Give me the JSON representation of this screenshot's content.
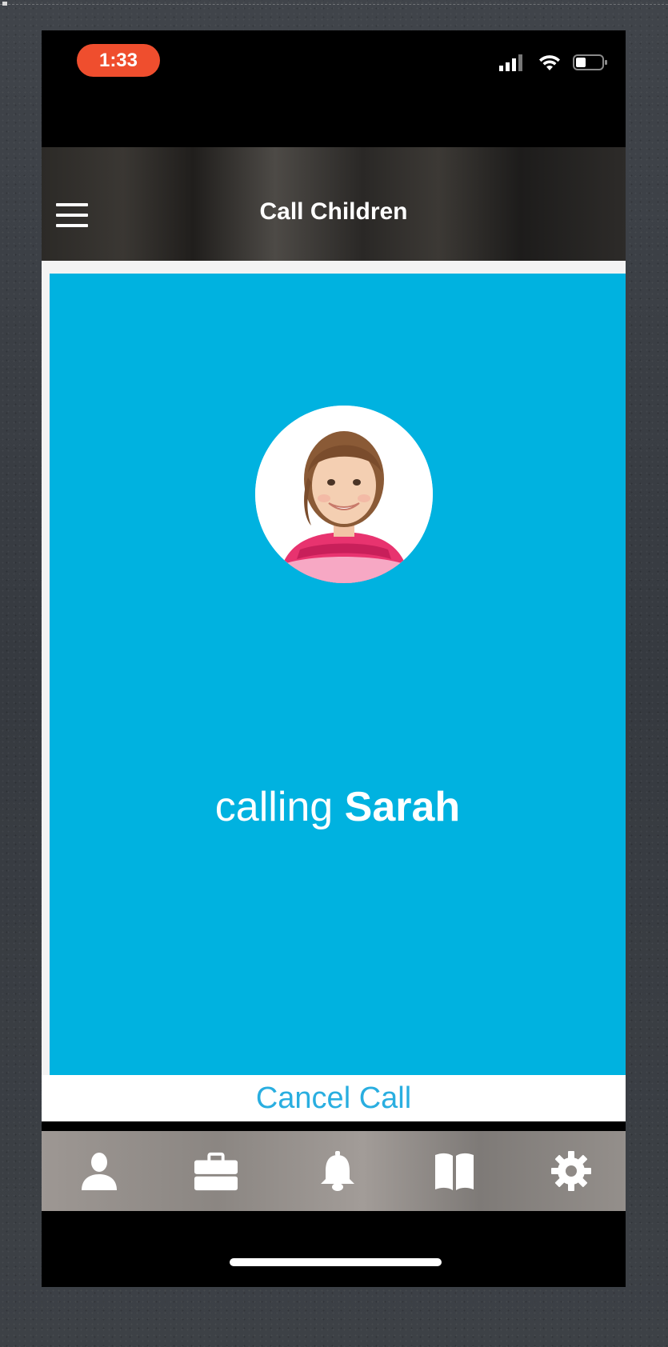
{
  "status_bar": {
    "time": "1:33",
    "time_pill_color": "#ef4e2e",
    "icons": [
      "signal-icon",
      "wifi-icon",
      "battery-icon"
    ]
  },
  "header": {
    "title": "Call Children",
    "menu_icon": "hamburger-menu-icon"
  },
  "call": {
    "calling_prefix": "calling",
    "callee_name": "Sarah",
    "background_color": "#00b2e0",
    "cancel_label": "Cancel Call",
    "cancel_color": "#29aee0"
  },
  "tab_bar": {
    "items": [
      {
        "icon": "person-icon"
      },
      {
        "icon": "briefcase-icon"
      },
      {
        "icon": "bell-icon"
      },
      {
        "icon": "book-icon"
      },
      {
        "icon": "gear-icon"
      }
    ]
  }
}
